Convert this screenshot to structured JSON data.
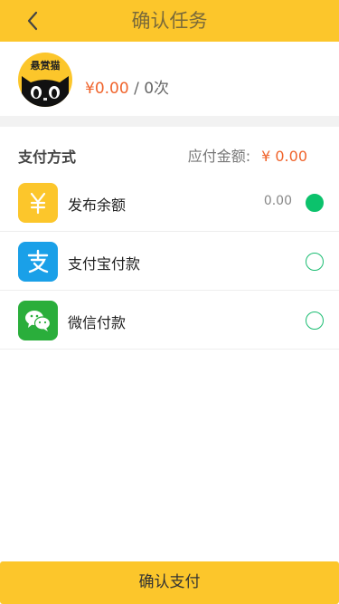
{
  "header": {
    "title": "确认任务"
  },
  "task": {
    "logo_text": "悬赏猫",
    "amount": "¥0.00",
    "separator": " / ",
    "count": "0次"
  },
  "payment": {
    "section_title": "支付方式",
    "due_label": "应付金额:",
    "due_amount": "¥ 0.00",
    "methods": [
      {
        "label": "发布余额",
        "balance": "0.00",
        "icon": "yen-icon",
        "icon_color": "#fcc62b",
        "selected": true
      },
      {
        "label": "支付宝付款",
        "icon": "alipay-icon",
        "icon_color": "#1aa0e8",
        "selected": false
      },
      {
        "label": "微信付款",
        "icon": "wechat-icon",
        "icon_color": "#2aae3b",
        "selected": false
      }
    ]
  },
  "footer": {
    "confirm_label": "确认支付"
  },
  "colors": {
    "brand": "#fcc62b",
    "accent": "#f0642c",
    "radio": "#0cc26c"
  }
}
